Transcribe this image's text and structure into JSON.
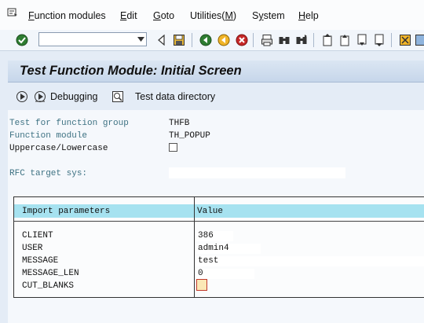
{
  "menu": {
    "items": [
      {
        "label": "Function modules",
        "accel": "F"
      },
      {
        "label": "Edit",
        "accel": "E"
      },
      {
        "label": "Goto",
        "accel": "G"
      },
      {
        "label": "Utilities(M)",
        "accel": "M"
      },
      {
        "label": "System",
        "accel": "y"
      },
      {
        "label": "Help",
        "accel": "H"
      }
    ]
  },
  "toolbar": {
    "command_field_value": "",
    "icons": [
      "enter-icon",
      "back-icon",
      "save-icon",
      "back-green-icon",
      "exit-icon",
      "cancel-icon",
      "print-icon",
      "find-icon",
      "find-next-icon",
      "first-page-icon",
      "previous-page-icon",
      "next-page-icon",
      "last-page-icon",
      "create-session-icon"
    ]
  },
  "title": {
    "text": "Test Function Module: Initial Screen"
  },
  "app_toolbar": {
    "debugging_label": "Debugging",
    "test_data_label": "Test data directory"
  },
  "form": {
    "function_group_label": "Test for function group",
    "function_group_value": "THFB",
    "function_module_label": "Function module",
    "function_module_value": "TH_POPUP",
    "uppercase_label": "Uppercase/Lowercase",
    "uppercase_checked": false,
    "rfc_label": "RFC target sys:",
    "rfc_value": ""
  },
  "params": {
    "header_name": "Import parameters",
    "header_value": "Value",
    "rows": [
      {
        "name": "CLIENT",
        "value": "386"
      },
      {
        "name": "USER",
        "value": "admin4"
      },
      {
        "name": "MESSAGE",
        "value": "test"
      },
      {
        "name": "MESSAGE_LEN",
        "value": "0"
      },
      {
        "name": "CUT_BLANKS",
        "value": ""
      }
    ]
  }
}
